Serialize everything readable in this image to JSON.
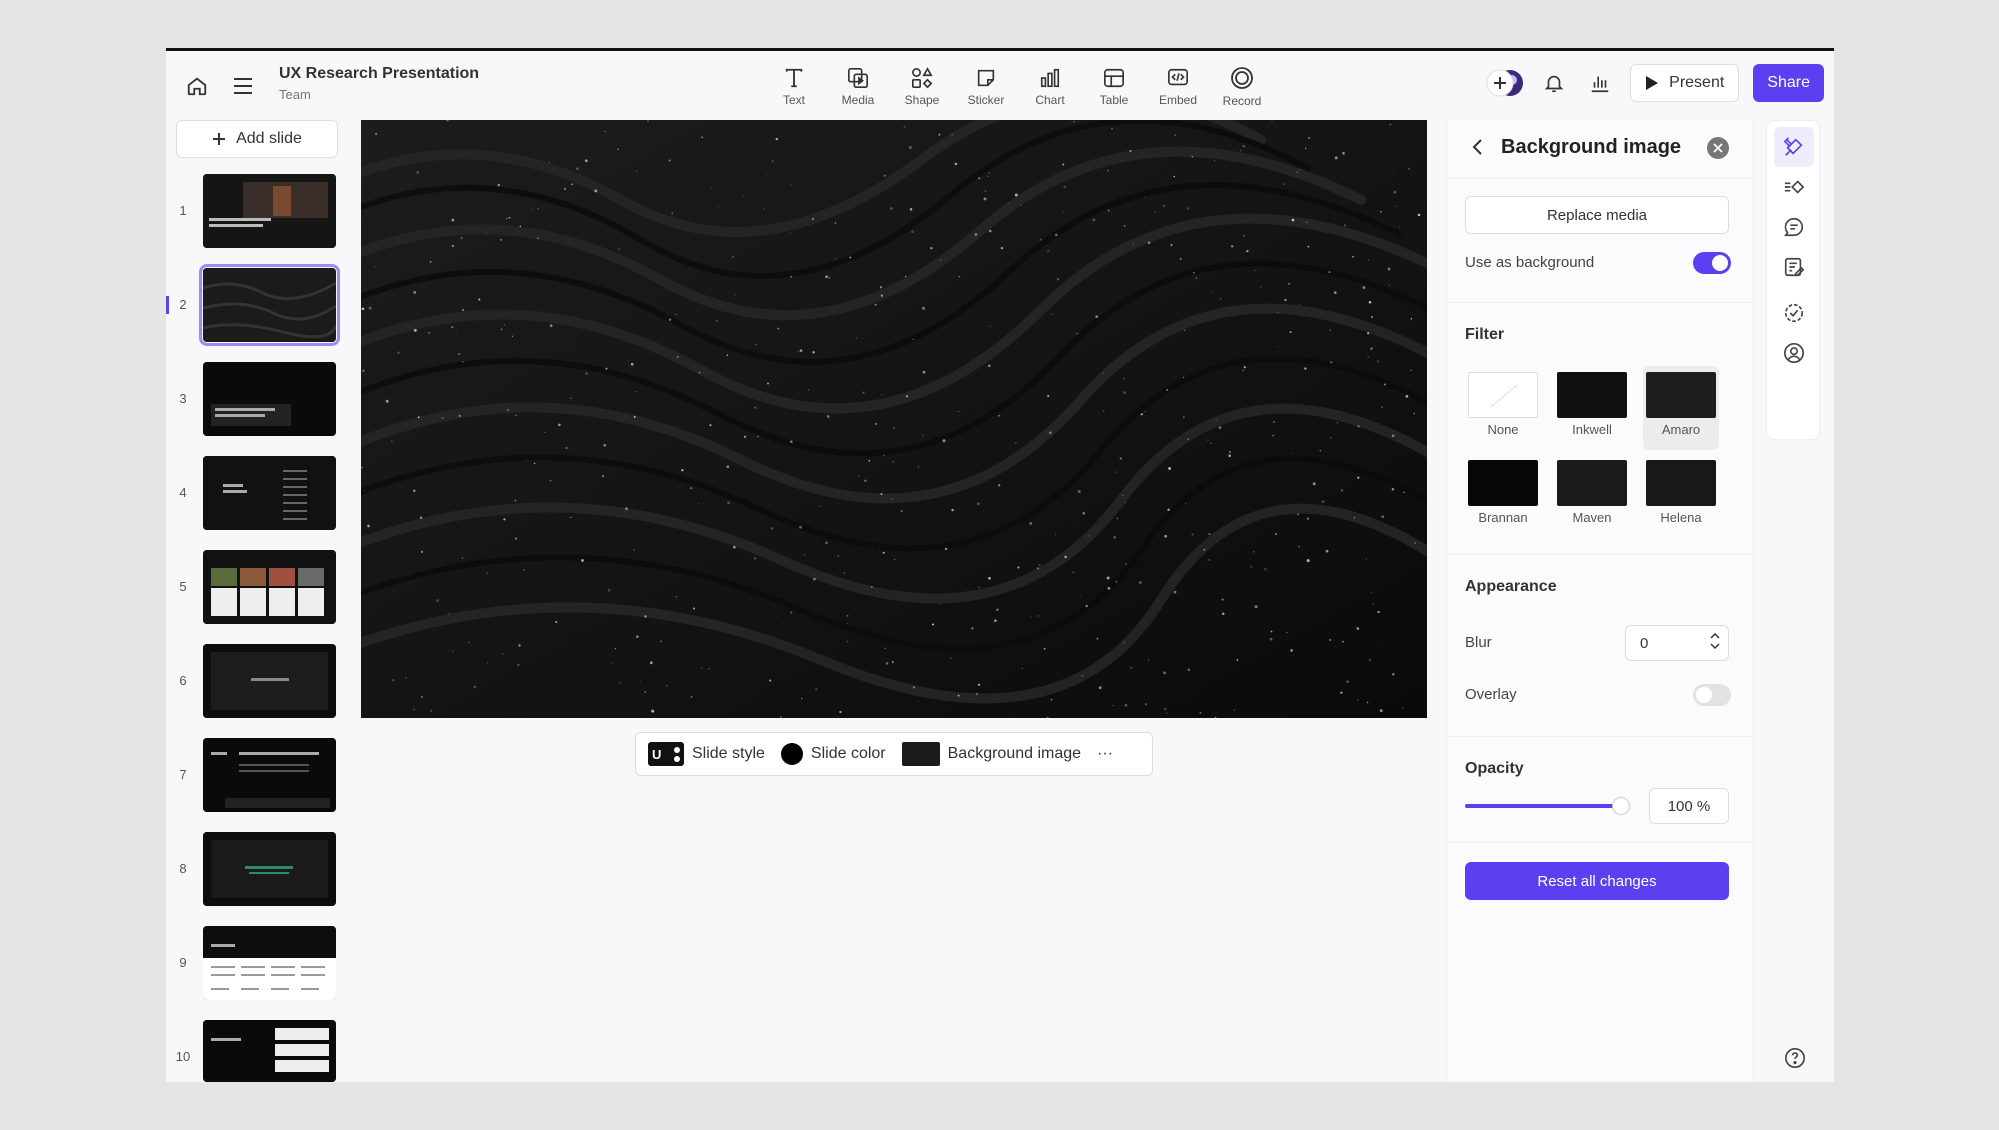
{
  "document": {
    "title": "UX Research Presentation",
    "subtitle": "Team"
  },
  "toolbar": {
    "tools": [
      {
        "label": "Text",
        "icon": "text-icon"
      },
      {
        "label": "Media",
        "icon": "media-icon"
      },
      {
        "label": "Shape",
        "icon": "shape-icon"
      },
      {
        "label": "Sticker",
        "icon": "sticker-icon"
      },
      {
        "label": "Chart",
        "icon": "chart-icon"
      },
      {
        "label": "Table",
        "icon": "table-icon"
      },
      {
        "label": "Embed",
        "icon": "embed-icon"
      },
      {
        "label": "Record",
        "icon": "record-icon"
      }
    ],
    "present_label": "Present",
    "share_label": "Share"
  },
  "sidebar": {
    "add_slide_label": "Add slide",
    "selected_slide": 2,
    "slides": [
      {
        "number": "1"
      },
      {
        "number": "2"
      },
      {
        "number": "3"
      },
      {
        "number": "4"
      },
      {
        "number": "5"
      },
      {
        "number": "6"
      },
      {
        "number": "7"
      },
      {
        "number": "8"
      },
      {
        "number": "9"
      },
      {
        "number": "10"
      }
    ]
  },
  "slide_toolbar": {
    "slide_style_label": "Slide style",
    "slide_style_badge": "U",
    "slide_color_label": "Slide color",
    "background_image_label": "Background image",
    "more_label": "···"
  },
  "panel": {
    "title": "Background image",
    "replace_media_label": "Replace media",
    "use_as_background_label": "Use as background",
    "use_as_background_on": true,
    "filter_heading": "Filter",
    "filters": [
      {
        "label": "None"
      },
      {
        "label": "Inkwell"
      },
      {
        "label": "Amaro"
      },
      {
        "label": "Brannan"
      },
      {
        "label": "Maven"
      },
      {
        "label": "Helena"
      }
    ],
    "selected_filter": "Amaro",
    "appearance_heading": "Appearance",
    "blur_label": "Blur",
    "blur_value": "0",
    "overlay_label": "Overlay",
    "overlay_on": false,
    "opacity_heading": "Opacity",
    "opacity_value": "100 %",
    "opacity_fraction": 1.0,
    "reset_label": "Reset all changes"
  },
  "colors": {
    "accent": "#5b3ff0",
    "canvas": "#0d0d0d"
  }
}
